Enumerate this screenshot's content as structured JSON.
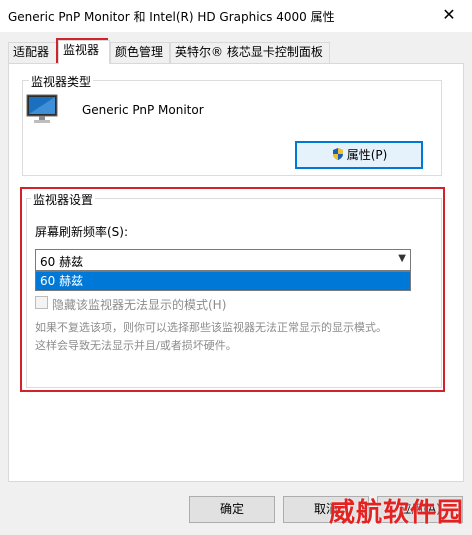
{
  "window": {
    "title": "Generic PnP Monitor 和 Intel(R) HD Graphics 4000 属性",
    "close_glyph": "✕"
  },
  "tabs": [
    {
      "label": "适配器"
    },
    {
      "label": "监视器"
    },
    {
      "label": "颜色管理"
    },
    {
      "label": "英特尔® 核芯显卡控制面板"
    }
  ],
  "monitor_type": {
    "group_title": "监视器类型",
    "monitor_name": "Generic PnP Monitor",
    "properties_button": "属性(P)"
  },
  "monitor_settings": {
    "group_title": "监视器设置",
    "refresh_label": "屏幕刷新频率(S):",
    "refresh_value": "60 赫兹",
    "dropdown_options": [
      "60 赫兹"
    ],
    "hide_modes_checkbox": "隐藏该监视器无法显示的模式(H)",
    "hide_modes_checked": false,
    "description_line1": "如果不复选该项，则你可以选择那些该监视器无法正常显示的显示模式。",
    "description_line2": "这样会导致无法显示并且/或者损坏硬件。"
  },
  "buttons": {
    "ok": "确定",
    "cancel": "取消",
    "apply": "应用(A)"
  },
  "watermark": "威航软件园",
  "colors": {
    "highlight_red": "#d2232a",
    "selection_blue": "#0078d7"
  }
}
